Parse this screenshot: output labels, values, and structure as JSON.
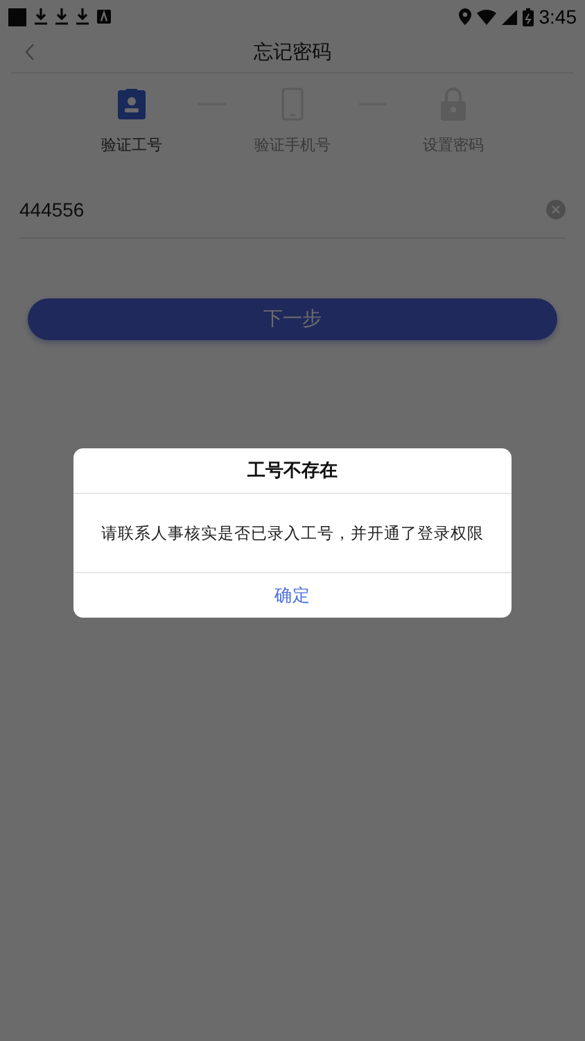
{
  "status_bar": {
    "time": "3:45"
  },
  "header": {
    "title": "忘记密码"
  },
  "steps": [
    {
      "label": "验证工号",
      "selected": true,
      "kind": "badge"
    },
    {
      "label": "验证手机号",
      "selected": false,
      "kind": "phone"
    },
    {
      "label": "设置密码",
      "selected": false,
      "kind": "lock"
    }
  ],
  "employee_id_field": {
    "value": "444556"
  },
  "next_button": {
    "label": "下一步"
  },
  "dialog": {
    "title": "工号不存在",
    "message": "请联系人事核实是否已录入工号，并开通了登录权限",
    "button": "确定"
  }
}
